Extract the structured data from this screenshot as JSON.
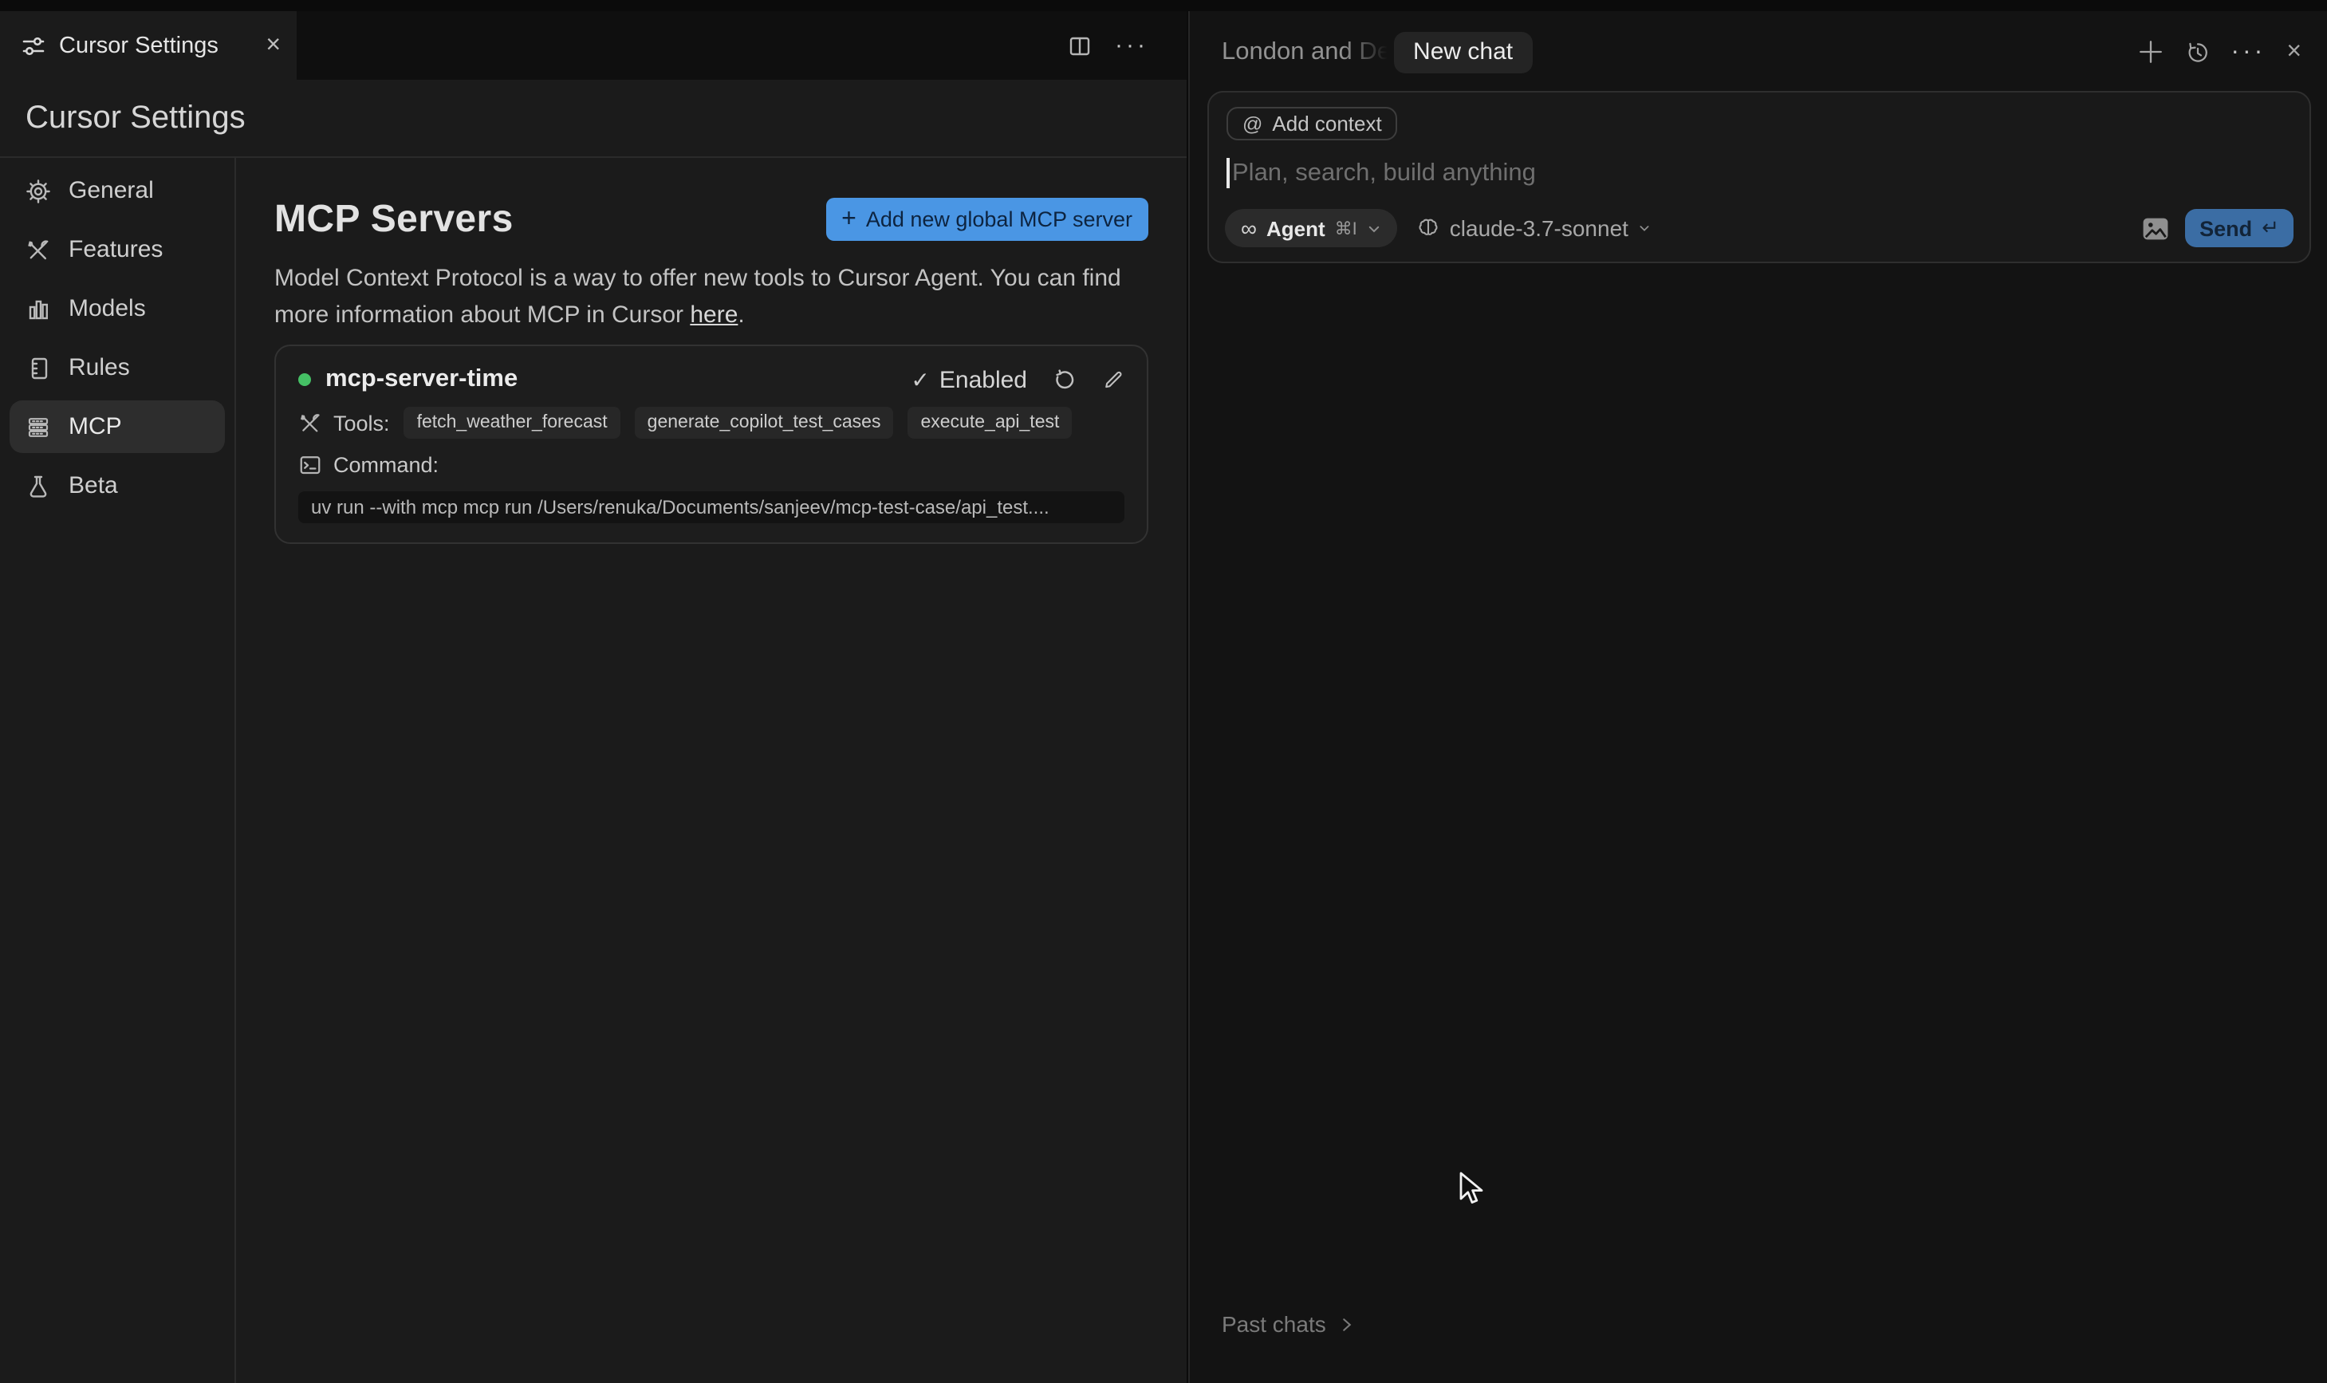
{
  "colors": {
    "accent_blue": "#4a96e4",
    "send_blue": "#3b6da4",
    "status_green": "#45c065",
    "pane_bg": "#1b1b1b",
    "chat_bg": "#131313"
  },
  "window": {
    "tab_title": "Cursor Settings",
    "tab_close": "×",
    "strip_ellipsis": "···"
  },
  "settings": {
    "page_title": "Cursor Settings",
    "sidebar": {
      "items": [
        {
          "label": "General",
          "icon": "gear-icon",
          "active": false
        },
        {
          "label": "Features",
          "icon": "tools-icon",
          "active": false
        },
        {
          "label": "Models",
          "icon": "bar-chart-icon",
          "active": false
        },
        {
          "label": "Rules",
          "icon": "rules-doc-icon",
          "active": false
        },
        {
          "label": "MCP",
          "icon": "server-stack-icon",
          "active": true
        },
        {
          "label": "Beta",
          "icon": "flask-icon",
          "active": false
        }
      ]
    },
    "mcp": {
      "heading": "MCP Servers",
      "add_button": "Add new global MCP server",
      "add_button_plus": "+",
      "description_line1": "Model Context Protocol is a way to offer new tools to Cursor Agent. You can find",
      "description_line2_prefix": "more information about MCP in Cursor ",
      "link_text": "here",
      "description_suffix": ".",
      "server": {
        "name": "mcp-server-time",
        "status_check": "✓",
        "status": "Enabled",
        "tools_label": "Tools:",
        "tools": [
          "fetch_weather_forecast",
          "generate_copilot_test_cases",
          "execute_api_test"
        ],
        "command_label": "Command:",
        "command": "uv run --with mcp mcp run /Users/renuka/Documents/sanjeev/mcp-test-case/api_test...."
      }
    }
  },
  "chat": {
    "previous_tab_title": "London and De",
    "active_tab": "New chat",
    "header_ellipsis": "···",
    "header_close": "×",
    "add_context_at": "@",
    "add_context": "Add context",
    "input_placeholder": "Plan, search, build anything",
    "mode_icon": "∞",
    "mode": "Agent",
    "mode_shortcut": "⌘I",
    "model": "claude-3.7-sonnet",
    "send_label": "Send",
    "send_return_glyph": "↵",
    "past_chats": "Past chats"
  }
}
